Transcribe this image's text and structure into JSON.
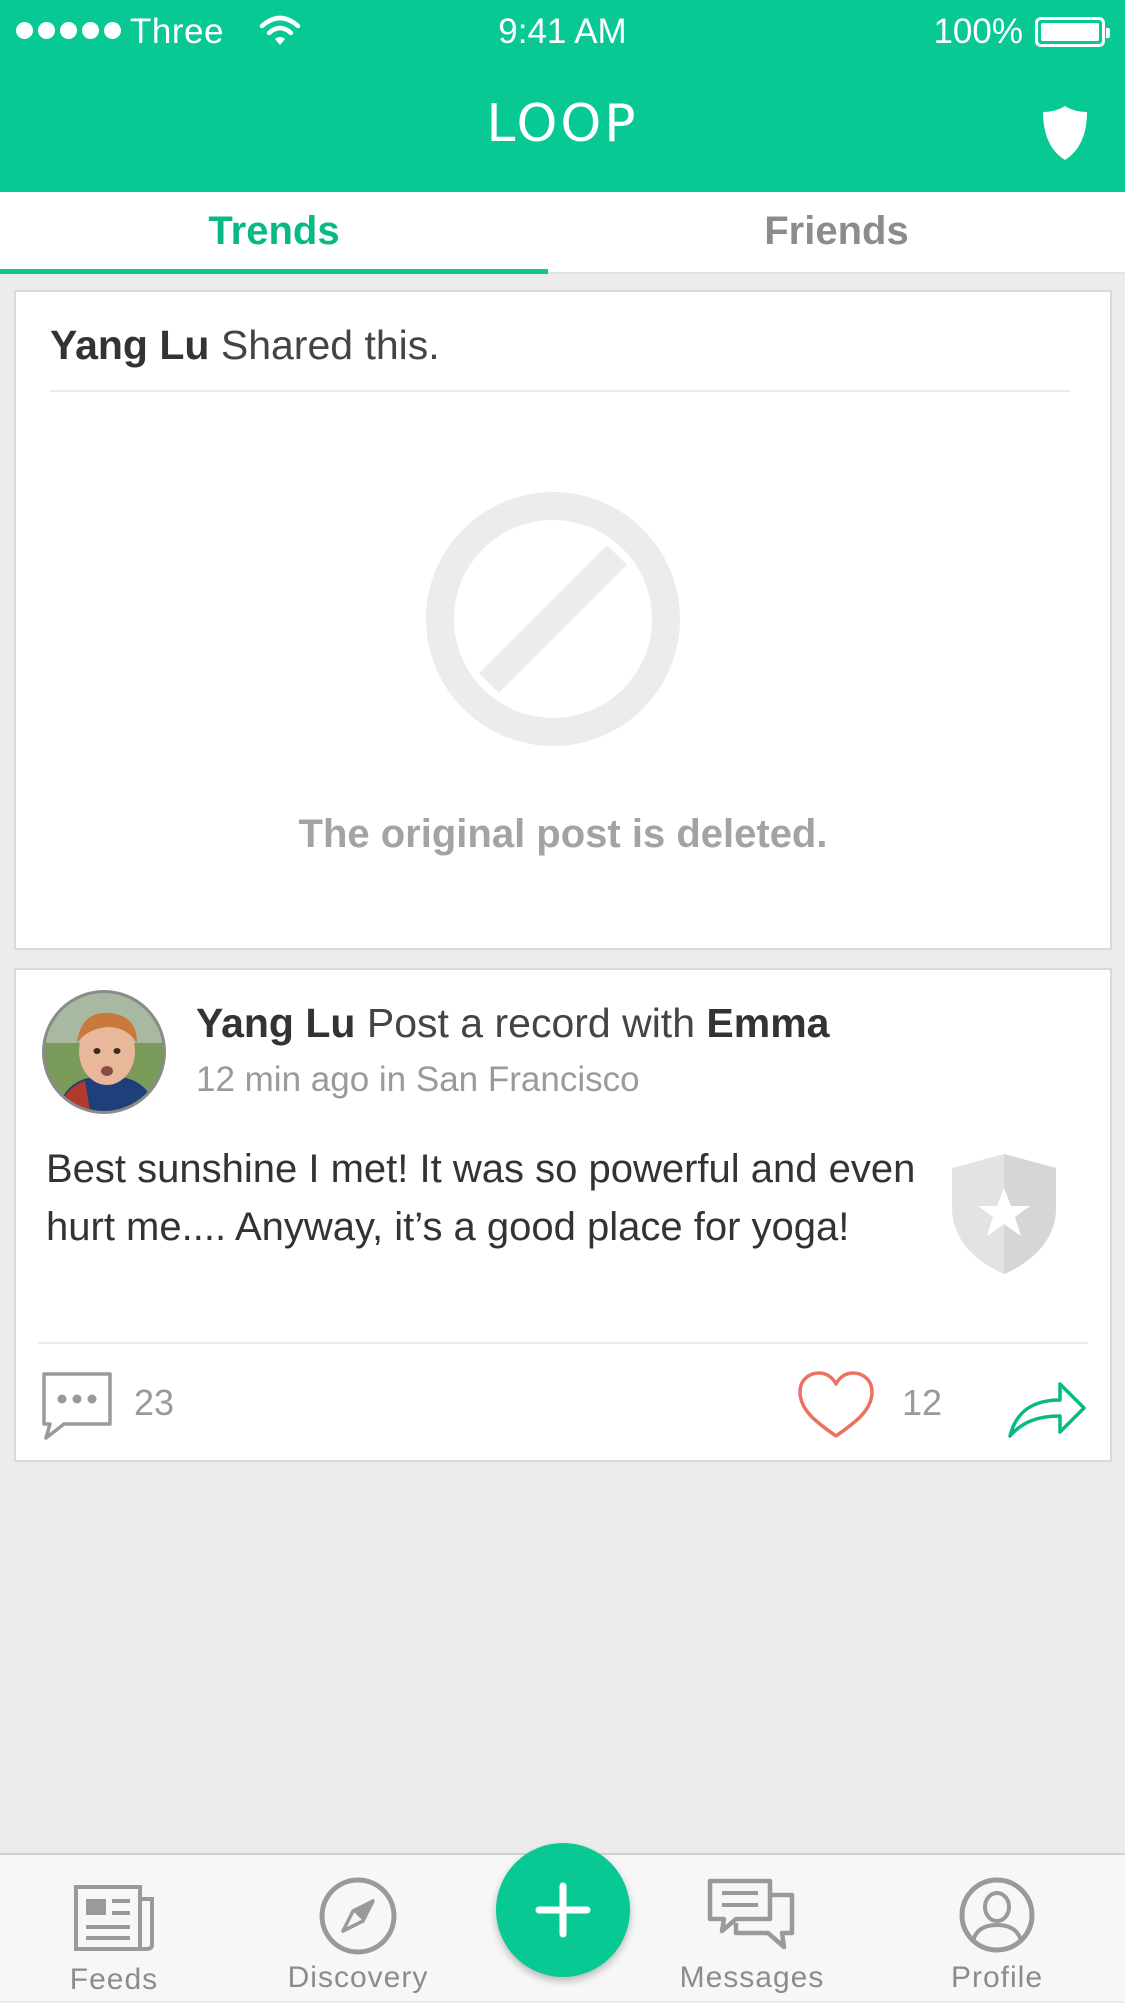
{
  "status_bar": {
    "carrier": "Three",
    "time": "9:41 AM",
    "battery": "100%"
  },
  "header": {
    "title": "LOOP",
    "right_icon": "shield-icon"
  },
  "tabs": [
    {
      "label": "Trends",
      "active": true
    },
    {
      "label": "Friends",
      "active": false
    }
  ],
  "shared_card": {
    "author": "Yang Lu",
    "action": " Shared this.",
    "deleted_message": "The original post is deleted.",
    "icon": "prohibited-icon"
  },
  "post_card": {
    "author": "Yang Lu",
    "action": " Post a record with ",
    "with": "Emma",
    "meta": "12 min ago in San Francisco",
    "text": "Best sunshine I met! It was so powerful and even hurt me.... Anyway, it’s a good place for yoga!",
    "badge_icon": "star-shield-icon",
    "comment_count": "23",
    "like_count": "12"
  },
  "bottom_nav": {
    "items": [
      {
        "label": "Feeds",
        "icon": "newspaper-icon"
      },
      {
        "label": "Discovery",
        "icon": "compass-icon"
      },
      {
        "label": "Messages",
        "icon": "chat-bubbles-icon"
      },
      {
        "label": "Profile",
        "icon": "person-icon"
      }
    ],
    "fab_icon": "plus-icon"
  },
  "colors": {
    "accent": "#08c993",
    "heart": "#e8735f"
  }
}
